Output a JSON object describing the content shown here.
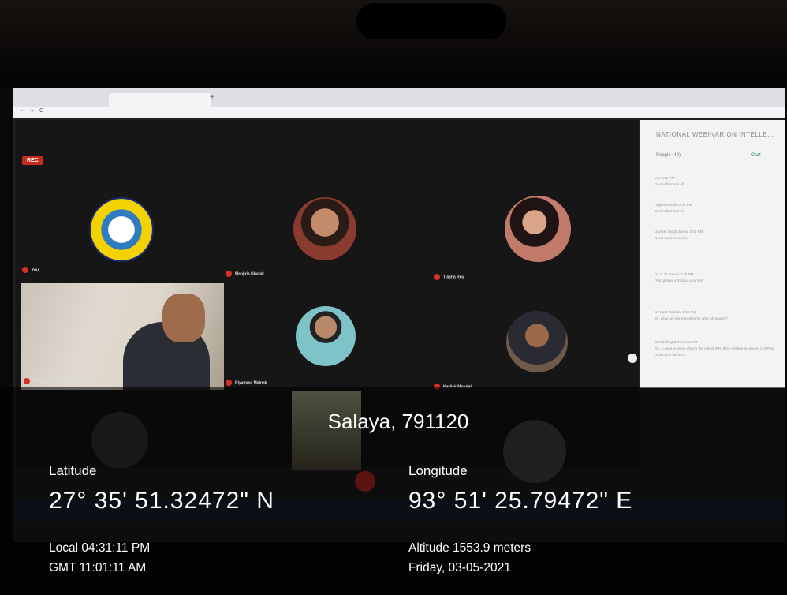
{
  "meeting": {
    "rec_badge": "REC",
    "participants": [
      {
        "name": "You"
      },
      {
        "name": "Manjula Ghatak"
      },
      {
        "name": "Tiasha Roy"
      },
      {
        "name": "IPR CELL NIT Arunachal Pradesh"
      },
      {
        "name": "Riyamma Mainak"
      },
      {
        "name": "Kartick Mondal"
      }
    ]
  },
  "side_panel": {
    "title": "NATIONAL WEBINAR ON INTELLE...",
    "people_tab": "People (49)",
    "chat_tab": "Chat",
    "messages": [
      {
        "sender": "You",
        "time": "1:11 PM",
        "text": "Good afternoon all"
      },
      {
        "sender": "Rajeev Ranjan",
        "time": "2:24 PM",
        "text": "Good afternoon sir"
      },
      {
        "sender": "Dilpreet Singh Jaswal",
        "time": "2:40 PM",
        "text": "Good noon everyone"
      },
      {
        "sender": "Dr. S. N. Dawar",
        "time": "2:46 PM",
        "text": "Prof. please introduce yourself"
      },
      {
        "sender": "Dr Vipul Talukdar",
        "time": "2:59 PM",
        "text": "Sir, what are the remedies for prior art search?"
      },
      {
        "sender": "Gambehing Dehui",
        "time": "3:01 PM",
        "text": "Sir... I want to know what is the role of IPR office relating to misuse of IPR to protect the owners..."
      }
    ]
  },
  "geotag": {
    "location": "Salaya, 791120",
    "latitude_label": "Latitude",
    "latitude_value": "27° 35' 51.32472\" N",
    "longitude_label": "Longitude",
    "longitude_value": "93° 51' 25.79472\" E",
    "local_time": "Local 04:31:11 PM",
    "gmt_time": "GMT 11:01:11 AM",
    "altitude": "Altitude 1553.9 meters",
    "date": "Friday, 03-05-2021"
  },
  "colors": {
    "rec_red": "#c52b1e",
    "mic_red": "#d93025",
    "chat_green": "#0b8043"
  }
}
